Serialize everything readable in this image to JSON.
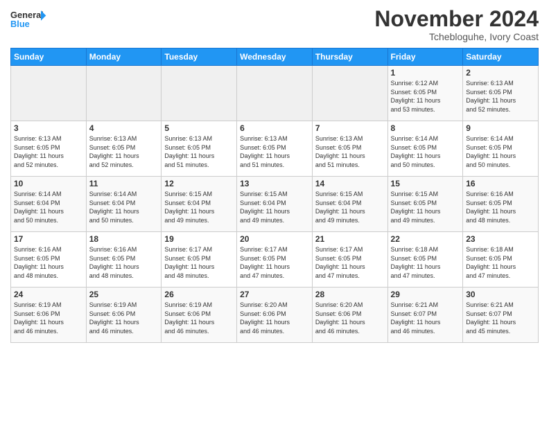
{
  "logo": {
    "line1": "General",
    "line2": "Blue"
  },
  "header": {
    "month": "November 2024",
    "location": "Tchebloguhe, Ivory Coast"
  },
  "weekdays": [
    "Sunday",
    "Monday",
    "Tuesday",
    "Wednesday",
    "Thursday",
    "Friday",
    "Saturday"
  ],
  "weeks": [
    [
      {
        "day": "",
        "info": ""
      },
      {
        "day": "",
        "info": ""
      },
      {
        "day": "",
        "info": ""
      },
      {
        "day": "",
        "info": ""
      },
      {
        "day": "",
        "info": ""
      },
      {
        "day": "1",
        "info": "Sunrise: 6:12 AM\nSunset: 6:05 PM\nDaylight: 11 hours\nand 53 minutes."
      },
      {
        "day": "2",
        "info": "Sunrise: 6:13 AM\nSunset: 6:05 PM\nDaylight: 11 hours\nand 52 minutes."
      }
    ],
    [
      {
        "day": "3",
        "info": "Sunrise: 6:13 AM\nSunset: 6:05 PM\nDaylight: 11 hours\nand 52 minutes."
      },
      {
        "day": "4",
        "info": "Sunrise: 6:13 AM\nSunset: 6:05 PM\nDaylight: 11 hours\nand 52 minutes."
      },
      {
        "day": "5",
        "info": "Sunrise: 6:13 AM\nSunset: 6:05 PM\nDaylight: 11 hours\nand 51 minutes."
      },
      {
        "day": "6",
        "info": "Sunrise: 6:13 AM\nSunset: 6:05 PM\nDaylight: 11 hours\nand 51 minutes."
      },
      {
        "day": "7",
        "info": "Sunrise: 6:13 AM\nSunset: 6:05 PM\nDaylight: 11 hours\nand 51 minutes."
      },
      {
        "day": "8",
        "info": "Sunrise: 6:14 AM\nSunset: 6:05 PM\nDaylight: 11 hours\nand 50 minutes."
      },
      {
        "day": "9",
        "info": "Sunrise: 6:14 AM\nSunset: 6:05 PM\nDaylight: 11 hours\nand 50 minutes."
      }
    ],
    [
      {
        "day": "10",
        "info": "Sunrise: 6:14 AM\nSunset: 6:04 PM\nDaylight: 11 hours\nand 50 minutes."
      },
      {
        "day": "11",
        "info": "Sunrise: 6:14 AM\nSunset: 6:04 PM\nDaylight: 11 hours\nand 50 minutes."
      },
      {
        "day": "12",
        "info": "Sunrise: 6:15 AM\nSunset: 6:04 PM\nDaylight: 11 hours\nand 49 minutes."
      },
      {
        "day": "13",
        "info": "Sunrise: 6:15 AM\nSunset: 6:04 PM\nDaylight: 11 hours\nand 49 minutes."
      },
      {
        "day": "14",
        "info": "Sunrise: 6:15 AM\nSunset: 6:04 PM\nDaylight: 11 hours\nand 49 minutes."
      },
      {
        "day": "15",
        "info": "Sunrise: 6:15 AM\nSunset: 6:05 PM\nDaylight: 11 hours\nand 49 minutes."
      },
      {
        "day": "16",
        "info": "Sunrise: 6:16 AM\nSunset: 6:05 PM\nDaylight: 11 hours\nand 48 minutes."
      }
    ],
    [
      {
        "day": "17",
        "info": "Sunrise: 6:16 AM\nSunset: 6:05 PM\nDaylight: 11 hours\nand 48 minutes."
      },
      {
        "day": "18",
        "info": "Sunrise: 6:16 AM\nSunset: 6:05 PM\nDaylight: 11 hours\nand 48 minutes."
      },
      {
        "day": "19",
        "info": "Sunrise: 6:17 AM\nSunset: 6:05 PM\nDaylight: 11 hours\nand 48 minutes."
      },
      {
        "day": "20",
        "info": "Sunrise: 6:17 AM\nSunset: 6:05 PM\nDaylight: 11 hours\nand 47 minutes."
      },
      {
        "day": "21",
        "info": "Sunrise: 6:17 AM\nSunset: 6:05 PM\nDaylight: 11 hours\nand 47 minutes."
      },
      {
        "day": "22",
        "info": "Sunrise: 6:18 AM\nSunset: 6:05 PM\nDaylight: 11 hours\nand 47 minutes."
      },
      {
        "day": "23",
        "info": "Sunrise: 6:18 AM\nSunset: 6:05 PM\nDaylight: 11 hours\nand 47 minutes."
      }
    ],
    [
      {
        "day": "24",
        "info": "Sunrise: 6:19 AM\nSunset: 6:06 PM\nDaylight: 11 hours\nand 46 minutes."
      },
      {
        "day": "25",
        "info": "Sunrise: 6:19 AM\nSunset: 6:06 PM\nDaylight: 11 hours\nand 46 minutes."
      },
      {
        "day": "26",
        "info": "Sunrise: 6:19 AM\nSunset: 6:06 PM\nDaylight: 11 hours\nand 46 minutes."
      },
      {
        "day": "27",
        "info": "Sunrise: 6:20 AM\nSunset: 6:06 PM\nDaylight: 11 hours\nand 46 minutes."
      },
      {
        "day": "28",
        "info": "Sunrise: 6:20 AM\nSunset: 6:06 PM\nDaylight: 11 hours\nand 46 minutes."
      },
      {
        "day": "29",
        "info": "Sunrise: 6:21 AM\nSunset: 6:07 PM\nDaylight: 11 hours\nand 46 minutes."
      },
      {
        "day": "30",
        "info": "Sunrise: 6:21 AM\nSunset: 6:07 PM\nDaylight: 11 hours\nand 45 minutes."
      }
    ]
  ]
}
